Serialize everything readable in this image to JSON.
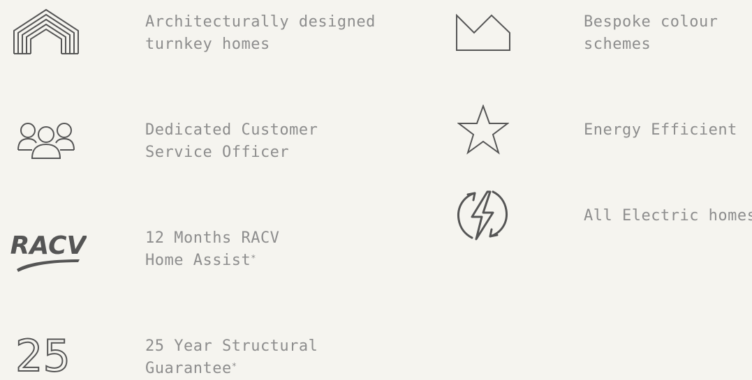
{
  "features": {
    "homes": {
      "line1": "Architecturally designed",
      "line2": "turnkey homes"
    },
    "colour": {
      "line1": "Bespoke colour",
      "line2": "schemes"
    },
    "service": {
      "line1": "Dedicated Customer",
      "line2": "Service Officer"
    },
    "energy": {
      "line1": "Energy Efficient"
    },
    "electric": {
      "line1": "All Electric homes"
    },
    "racv": {
      "line1": "12 Months RACV",
      "line2": "Home Assist",
      "mark": "*",
      "logo_text": "RACV"
    },
    "guarantee": {
      "line1": "25 Year Structural",
      "line2": "Guarantee",
      "mark": "*",
      "numeral": "25"
    }
  },
  "colors": {
    "icon": "#555555",
    "text": "#8d8d8d",
    "background": "#f5f4ef"
  }
}
